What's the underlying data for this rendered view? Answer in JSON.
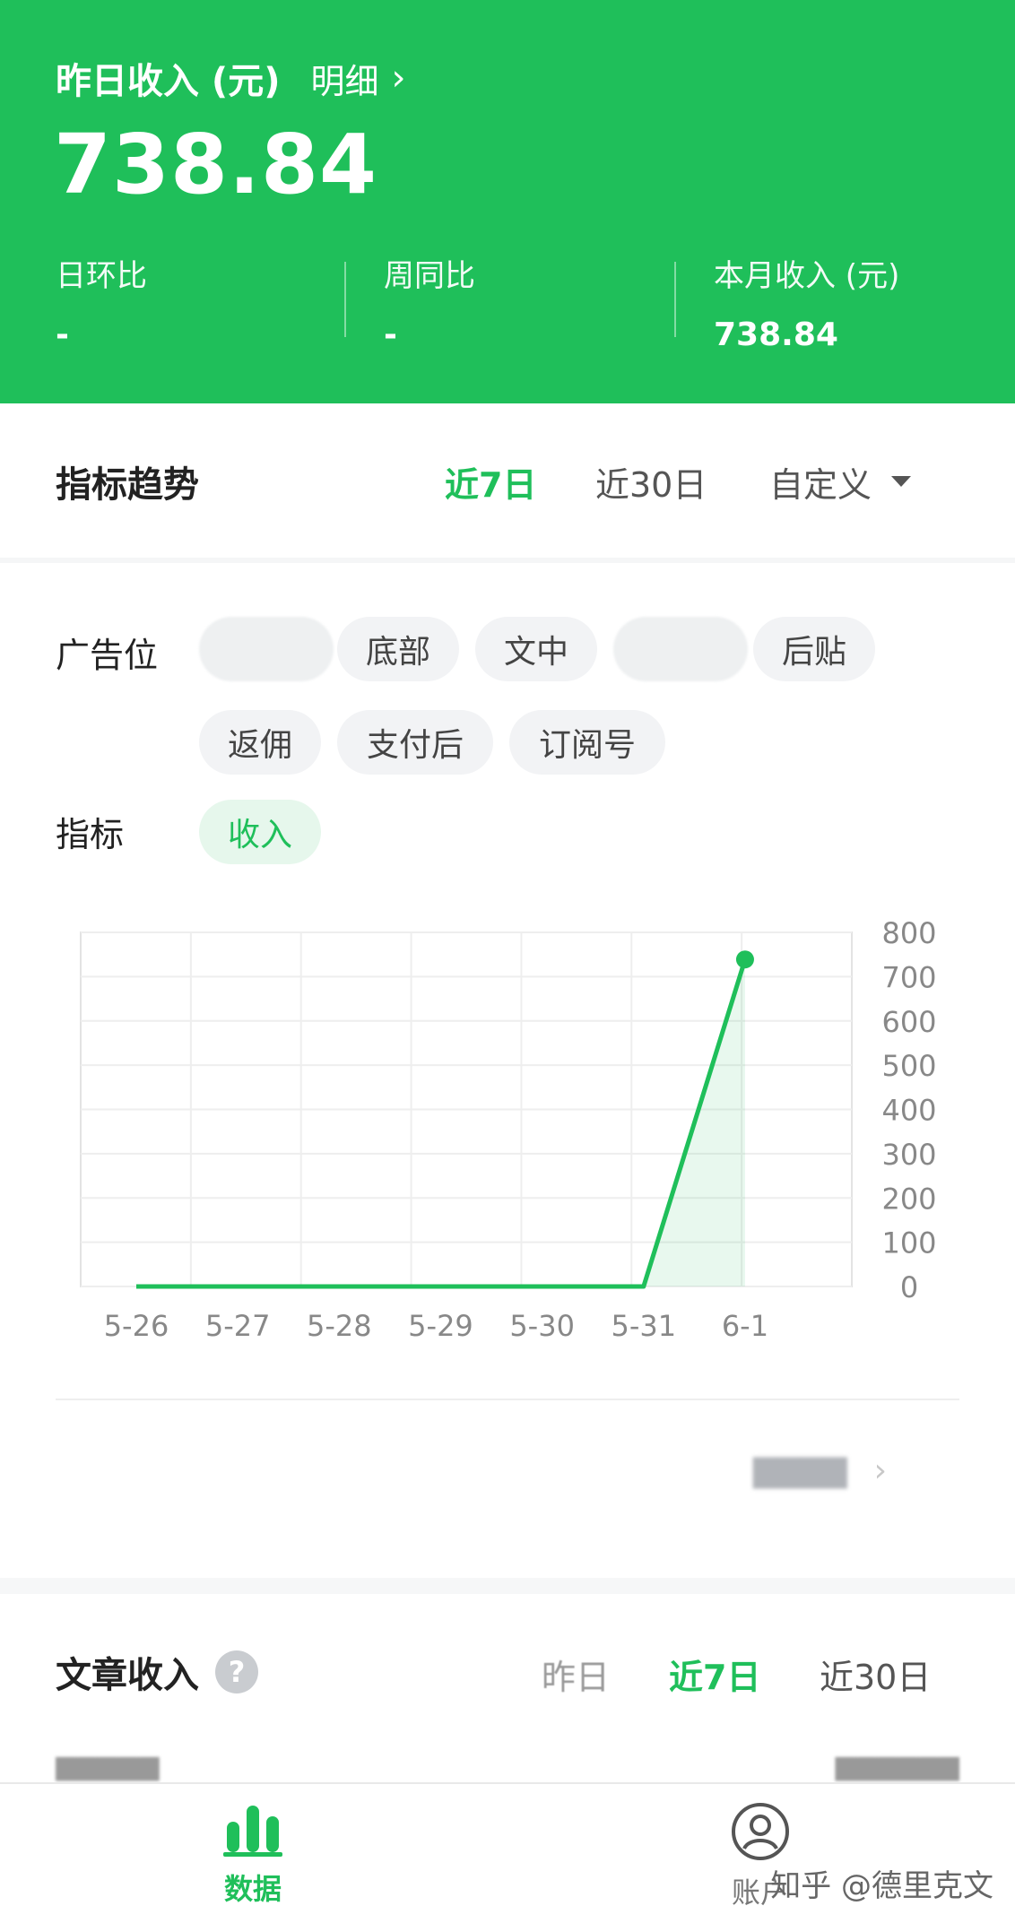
{
  "header": {
    "title": "昨日收入 (元)",
    "detail_link": "明细",
    "amount": "738.84",
    "stats": [
      {
        "label": "日环比",
        "value": "-"
      },
      {
        "label": "周同比",
        "value": "-"
      },
      {
        "label": "本月收入 (元)",
        "value": "738.84"
      }
    ]
  },
  "trend": {
    "title": "指标趋势",
    "tabs": [
      "近7日",
      "近30日",
      "自定义"
    ],
    "active_tab": "近7日"
  },
  "filters": {
    "ad_position_label": "广告位",
    "ad_positions": [
      "底部",
      "文中",
      "后贴",
      "返佣",
      "支付后",
      "订阅号"
    ],
    "metric_label": "指标",
    "metric": "收入"
  },
  "chart_data": {
    "type": "line",
    "x": [
      "5-26",
      "5-27",
      "5-28",
      "5-29",
      "5-30",
      "5-31",
      "6-1"
    ],
    "series": [
      {
        "values": [
          0,
          0,
          0,
          0,
          0,
          0,
          738.84
        ]
      }
    ],
    "y_ticks": [
      0,
      100,
      200,
      300,
      400,
      500,
      600,
      700,
      800
    ],
    "ylim": [
      0,
      800
    ],
    "grid": true,
    "y_axis_side": "right",
    "color": "#1fbf5a"
  },
  "article_income": {
    "title": "文章收入",
    "tabs": [
      "昨日",
      "近7日",
      "近30日"
    ],
    "active_tab": "近7日"
  },
  "bottom_nav": {
    "items": [
      {
        "label": "数据",
        "icon": "bar-chart-icon",
        "active": true
      },
      {
        "label": "账户",
        "icon": "user-circle-icon",
        "active": false
      }
    ]
  },
  "watermark": "知乎 @德里克文",
  "colors": {
    "brand": "#1fbf5a",
    "chip_bg": "#f2f3f5",
    "chip_active_bg": "#e6f7ec"
  }
}
